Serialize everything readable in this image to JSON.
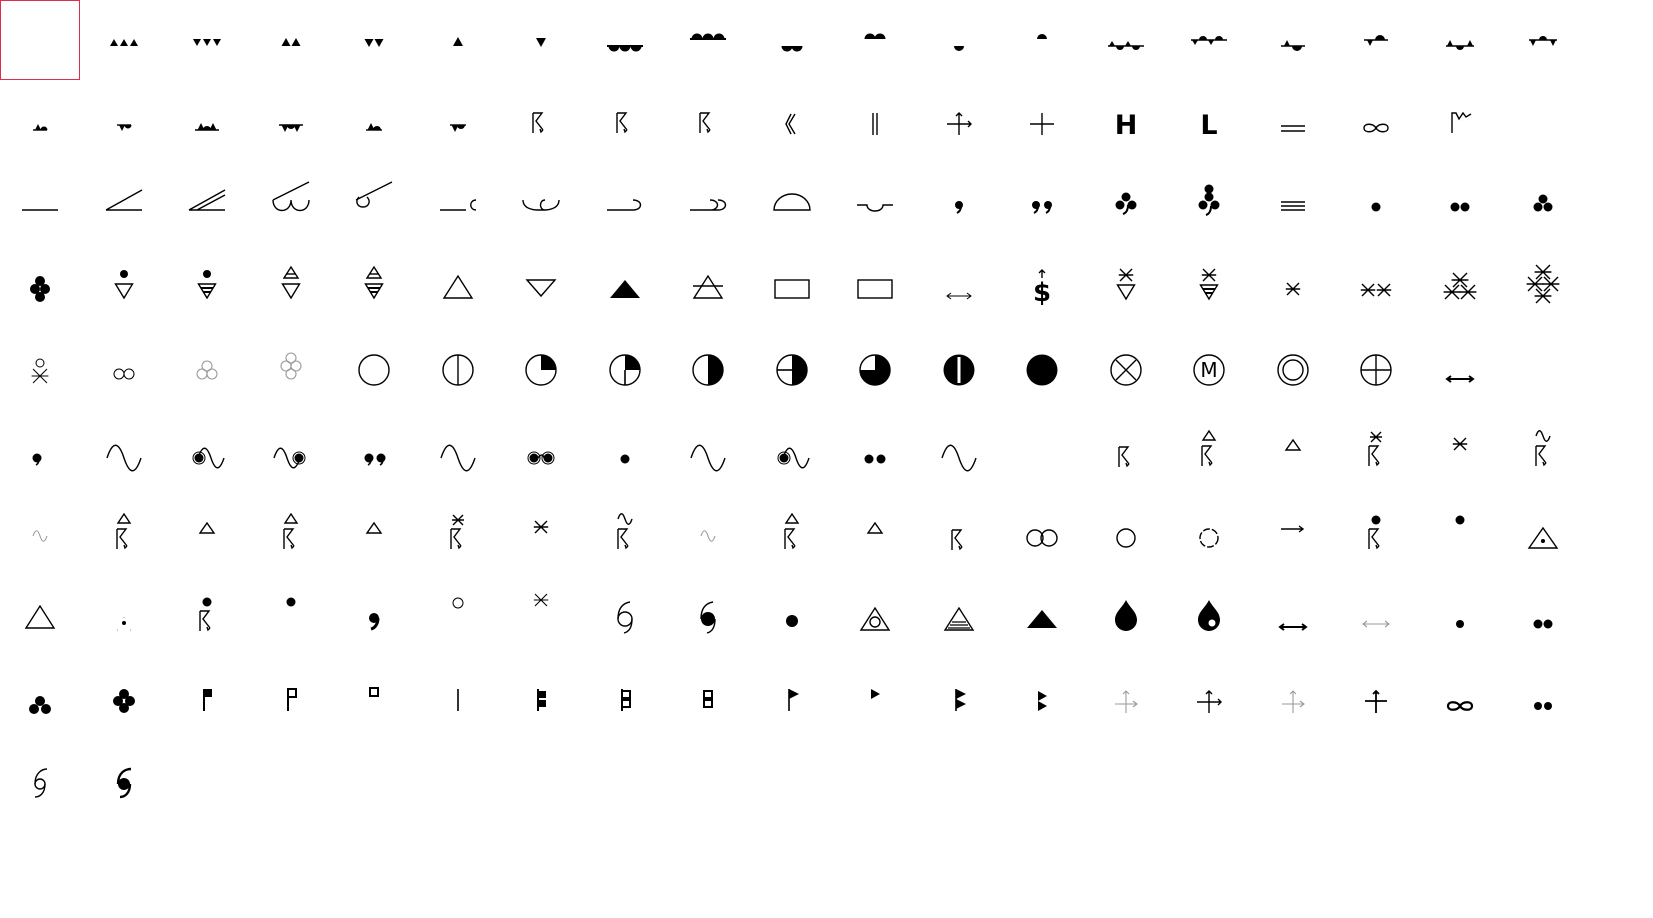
{
  "selection": {
    "index": 0,
    "color": "#d9314a"
  },
  "colors": {
    "background": "#ffffff",
    "glyph": "#000000",
    "faint": "#9a9a9a"
  },
  "rows": [
    [
      "blank",
      "warm-front-tri-3-up",
      "cold-front-tri-3-down",
      "warm-front-tri-2-up",
      "cold-front-tri-2-down",
      "front-tri-1-up",
      "front-tri-1-down",
      "warm-front-semi-3-up",
      "cold-front-semi-3-down",
      "warm-front-semi-2-up",
      "cold-front-semi-2-down",
      "front-semi-1-up",
      "front-semi-1-down",
      "occluded-front-alt-4",
      "stationary-front-alt-4",
      "occluded-front-alt-2",
      "stationary-front-alt-2",
      "occluded-front-alt-3",
      "stationary-front-alt-3"
    ],
    [
      "mixed-front-1",
      "mixed-front-2",
      "mixed-front-3",
      "mixed-front-4",
      "mixed-front-5",
      "mixed-front-6",
      "thunderstorm-sign",
      "thunderstorm-sign-hail",
      "thunderstorm-sign-2",
      "weak-bracket",
      "double-bar",
      "cross-arrows",
      "cross-plus",
      "letter-h",
      "letter-l",
      "equals",
      "infinity",
      "hook-sign"
    ],
    [
      "low-cloud-0",
      "low-cloud-1",
      "low-cloud-2",
      "low-cloud-3",
      "low-cloud-4",
      "low-cloud-5",
      "low-cloud-6",
      "low-cloud-7",
      "low-cloud-8",
      "dome-cloud",
      "cup-cloud",
      "drizzle-1",
      "drizzle-2",
      "drizzle-3",
      "drizzle-4",
      "fog-lines",
      "rain-1",
      "rain-2",
      "rain-3"
    ],
    [
      "rain-4",
      "rain-shower",
      "rain-shower-heavy",
      "snow-rain-shower",
      "snow-rain-shower-heavy",
      "triangle-outline",
      "triangle-down-outline",
      "triangle-filled",
      "triangle-strike",
      "rectangle-outline",
      "rectangle-outline-2",
      "double-arrow-small",
      "dollar-arrow",
      "snow-shower",
      "snow-shower-heavy",
      "snow-1",
      "snow-2",
      "snow-3",
      "snow-4"
    ],
    [
      "snow-rain",
      "hollow-2",
      "hollow-3",
      "hollow-4",
      "sky-clear",
      "sky-1-8",
      "sky-2-8",
      "sky-3-8",
      "sky-4-8",
      "sky-5-8",
      "sky-6-8",
      "sky-7-8",
      "sky-overcast",
      "sky-obscured",
      "sky-missing",
      "double-circle",
      "circle-plus",
      "double-arrow-bold"
    ],
    [
      "drizzle-dot-small",
      "tilde",
      "dot-tilde",
      "tilde-dot",
      "drizzle-double",
      "tilde",
      "dots-tilde",
      "rain-dot",
      "tilde",
      "dot-tilde",
      "rain-double",
      "tilde",
      "",
      "thunder-sign",
      "thunder-hail",
      "small-triangle",
      "thunder-snow",
      "small-snow",
      "thunder-tilde"
    ],
    [
      "faint-tilde",
      "thunder-hail",
      "small-triangle",
      "thunder-hail",
      "small-triangle",
      "thunder-snow",
      "small-snow",
      "thunder-tilde",
      "faint-tilde",
      "thunder-hail",
      "small-triangle",
      "thunder-sign",
      "double-ring",
      "ring",
      "dashed-ring",
      "arrow-right",
      "thunder-rain",
      "dot-top",
      "triangle-dot"
    ],
    [
      "triangle-outline",
      "dot-spark",
      "thunder-rain",
      "dot-top",
      "comma-large",
      "ring-small",
      "snow-small",
      "hurricane-open",
      "hurricane-filled",
      "dot",
      "triangle-circle",
      "triangle-lines",
      "triangle-filled",
      "drop",
      "drop-light",
      "double-arrow-bold",
      "double-arrow-faint",
      "dot-small",
      "double-dot-bold"
    ],
    [
      "three-dots",
      "four-dots",
      "flag-square",
      "flag-hollow-dot",
      "square-hollow",
      "vertical-line",
      "pennant-stack",
      "pennant-stack-hollow",
      "square-pair-hollow",
      "flag-triangle",
      "triangle-right",
      "triangles-double",
      "triangles-right",
      "cross-arrows-faint",
      "cross-arrows",
      "cross-arrows-faint",
      "cross-plus-bold",
      "infinity-bold",
      "double-dot"
    ],
    [
      "cyclone-open",
      "cyclone-filled"
    ]
  ]
}
